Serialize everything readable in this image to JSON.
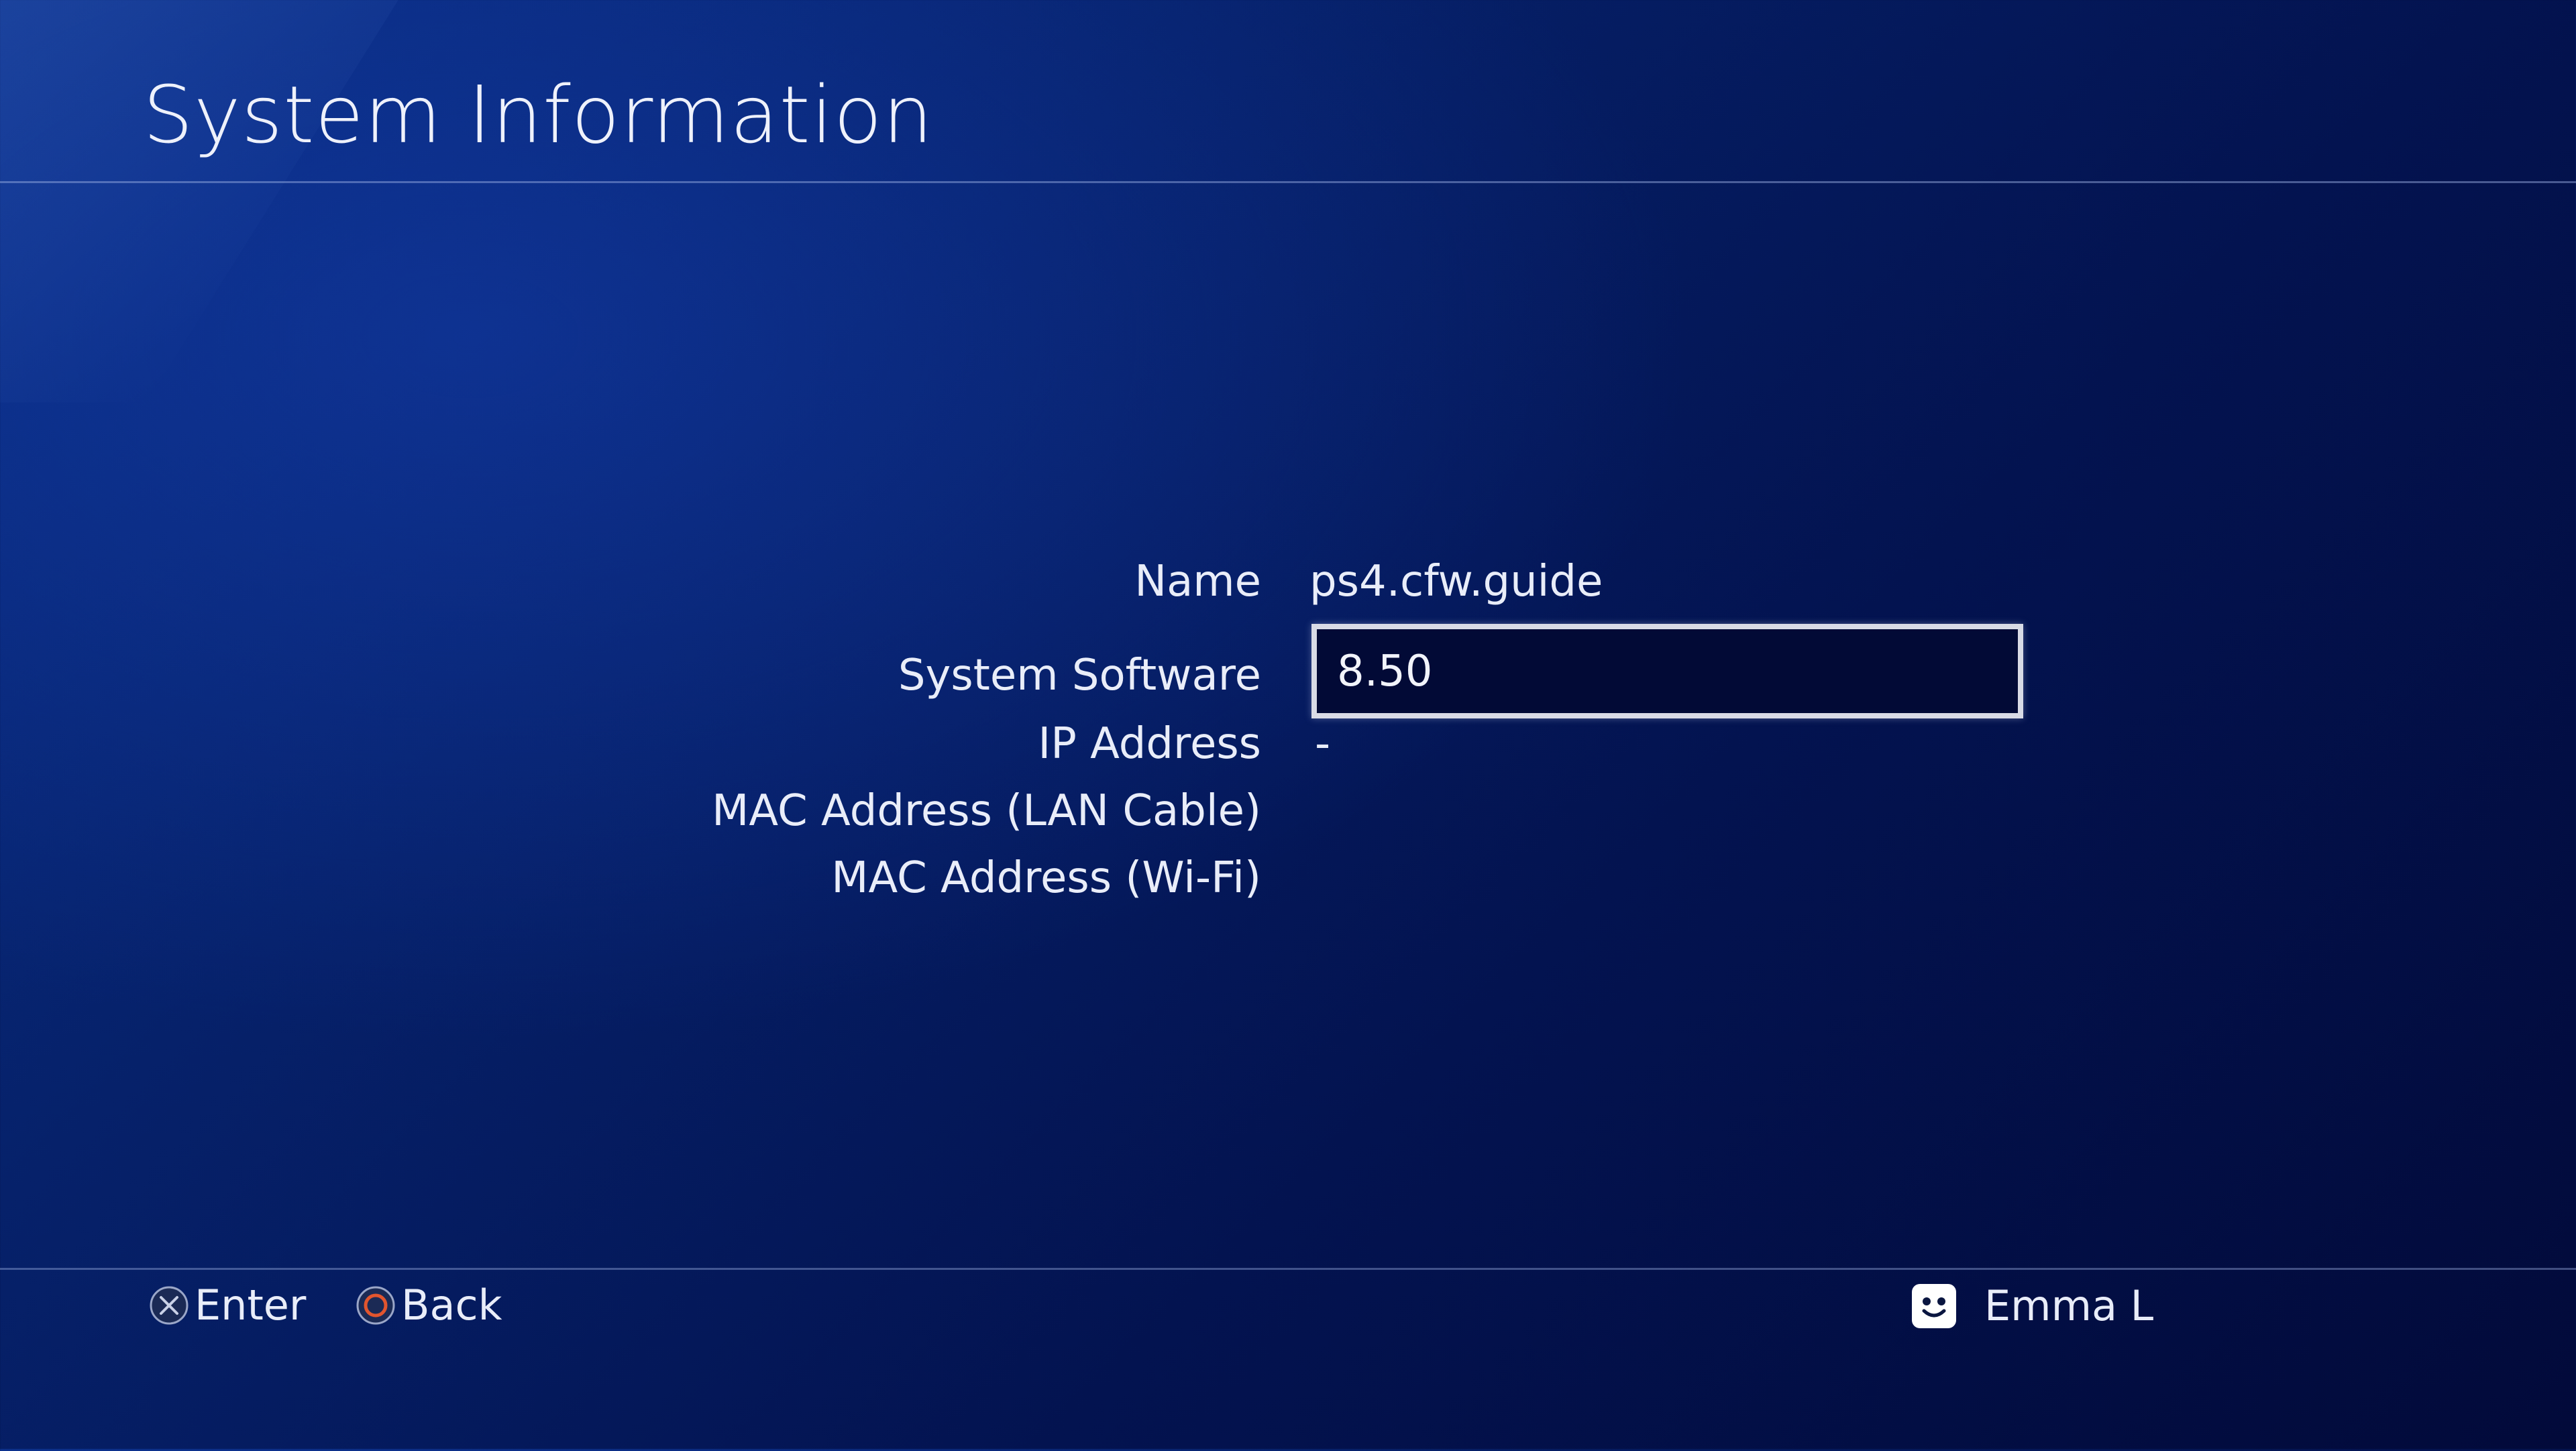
{
  "window": {
    "title": "System Information"
  },
  "system_info": {
    "rows": [
      {
        "label": "Name",
        "value": "ps4.cfw.guide"
      },
      {
        "label": "System Software",
        "value": "8.50",
        "focused": true
      },
      {
        "label": "IP Address",
        "value": "-"
      },
      {
        "label": "MAC Address (LAN Cable)",
        "value": ""
      },
      {
        "label": "MAC Address (Wi-Fi)",
        "value": ""
      }
    ]
  },
  "footer": {
    "buttons": [
      {
        "icon": "cross-button-icon",
        "label": "Enter"
      },
      {
        "icon": "circle-button-icon",
        "label": "Back"
      }
    ],
    "user": {
      "icon": "avatar-icon",
      "name": "Emma L"
    }
  },
  "colors": {
    "background_top": "#0a2f86",
    "background_bottom": "#020a3a",
    "focus_border": "#d9dbe6",
    "circle_button": "#e2552e",
    "text": "#eef1fb"
  }
}
